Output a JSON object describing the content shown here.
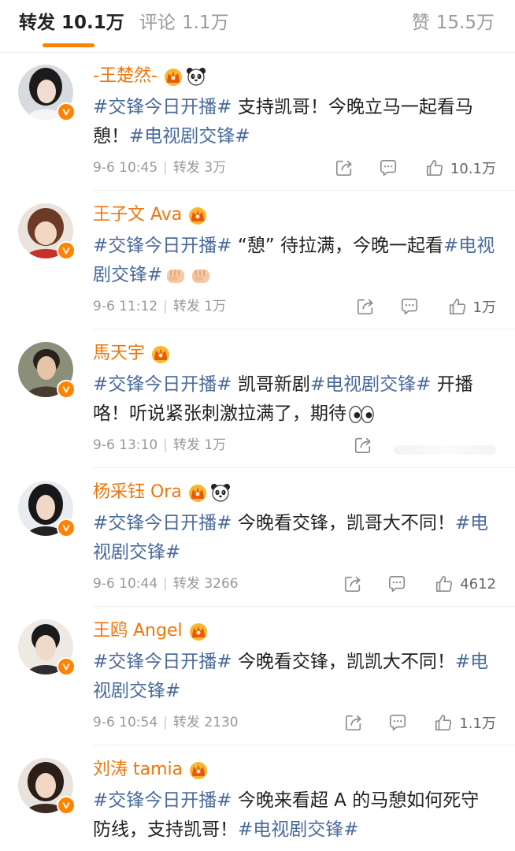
{
  "tabs": {
    "forward_label": "转发",
    "forward_count": "10.1万",
    "comment_label": "评论",
    "comment_count": "1.1万",
    "like_label": "赞",
    "like_count": "15.5万"
  },
  "meta_labels": {
    "repost": "转发"
  },
  "items": [
    {
      "name": "-王楚然-",
      "text1": "#交锋今日开播#",
      "text2": " 支持凯哥！今晚立马一起看马憩！",
      "text3": "#电视剧交锋#",
      "time": "9-6 10:45",
      "reposts": "3万",
      "likes": "10.1万"
    },
    {
      "name": "王子文 Ava",
      "text1": "#交锋今日开播#",
      "text2": " “憩” 待拉满，今晚一起看",
      "text3": "#电视剧交锋#",
      "time": "9-6 11:12",
      "reposts": "1万",
      "likes": "1万"
    },
    {
      "name": "馬天宇",
      "text1": "#交锋今日开播#",
      "text2": " 凯哥新剧",
      "text3": "#电视剧交锋#",
      "text4": " 开播咯！听说紧张刺激拉满了，期待",
      "time": "9-6 13:10",
      "reposts": "1万",
      "likes": ""
    },
    {
      "name": "杨采钰 Ora",
      "text1": "#交锋今日开播#",
      "text2": " 今晚看交锋，凯哥大不同！",
      "text3": "#电视剧交锋#",
      "time": "9-6 10:44",
      "reposts": "3266",
      "likes": "4612"
    },
    {
      "name": "王鸥 Angel",
      "text1": "#交锋今日开播#",
      "text2": " 今晚看交锋，凯凯大不同！",
      "text3": "#电视剧交锋#",
      "time": "9-6 10:54",
      "reposts": "2130",
      "likes": "1.1万"
    },
    {
      "name": "刘涛 tamia",
      "text1": "#交锋今日开播#",
      "text2": " 今晚来看超 A 的马憩如何死守防线，支持凯哥！",
      "text3": "#电视剧交锋#",
      "time": "",
      "reposts": "",
      "likes": ""
    }
  ],
  "colors": {
    "accent": "#ff8200",
    "nickname": "#f0750a",
    "topic": "#4a6a9c"
  },
  "icons": [
    "crown-badge-icon",
    "panda-icon",
    "verified-icon",
    "share-icon",
    "comment-icon",
    "like-icon",
    "fist-emoji-icon",
    "eyes-emoji-icon"
  ]
}
